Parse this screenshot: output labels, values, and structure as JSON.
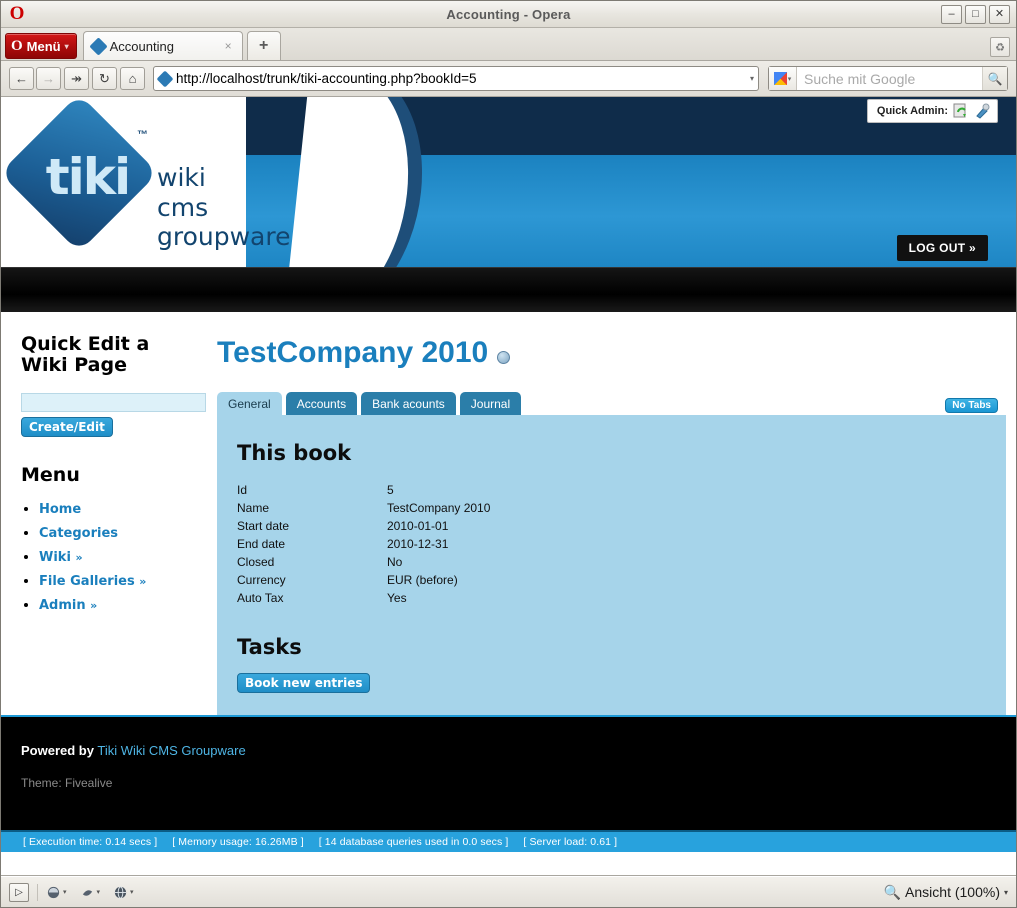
{
  "window": {
    "title": "Accounting - Opera",
    "app_icon": "opera-logo-icon",
    "minimize_label": "–",
    "maximize_label": "□",
    "close_label": "✕"
  },
  "tabbar": {
    "menu_label": "Menü",
    "menu_caret": "▾",
    "tabs": [
      {
        "label": "Accounting",
        "close_label": "×",
        "favicon": "tiki-favicon"
      }
    ],
    "new_tab_label": "+",
    "right_button_icon": "trash-icon"
  },
  "navbar": {
    "back_label": "←",
    "forward_label": "→",
    "fastforward_label": "↠",
    "reload_label": "↻",
    "home_label": "⌂",
    "url": "http://localhost/trunk/tiki-accounting.php?bookId=5",
    "url_dropdown_label": "▾",
    "search_engine_icon": "google-icon",
    "search_engine_caret": "▾",
    "search_placeholder": "Suche mit Google",
    "search_go_icon": "magnifier-icon"
  },
  "banner": {
    "logo_word": "tiki",
    "logo_tm": "™",
    "logo_sub_line1": "wiki",
    "logo_sub_line2": "cms",
    "logo_sub_line3": "groupware",
    "quick_admin_label": "Quick Admin:",
    "quick_admin_icons": [
      "refresh-page-icon",
      "wrench-icon"
    ],
    "logout_label": "LOG OUT »"
  },
  "sidebar": {
    "quick_edit": {
      "title": "Quick Edit a Wiki Page",
      "input_value": "",
      "input_placeholder": "",
      "button_label": "Create/Edit"
    },
    "menu": {
      "title": "Menu",
      "items": [
        {
          "label": "Home",
          "arrow": ""
        },
        {
          "label": "Categories",
          "arrow": ""
        },
        {
          "label": "Wiki",
          "arrow": "»"
        },
        {
          "label": "File Galleries",
          "arrow": "»"
        },
        {
          "label": "Admin",
          "arrow": "»"
        }
      ]
    }
  },
  "main": {
    "page_title": "TestCompany 2010",
    "help_icon": "help-icon",
    "no_tabs_label": "No Tabs",
    "tabs": [
      {
        "label": "General",
        "active": true
      },
      {
        "label": "Accounts",
        "active": false
      },
      {
        "label": "Bank acounts",
        "active": false
      },
      {
        "label": "Journal",
        "active": false
      }
    ],
    "book_section_title": "This book",
    "book_fields": [
      {
        "key": "Id",
        "value": "5"
      },
      {
        "key": "Name",
        "value": "TestCompany 2010"
      },
      {
        "key": "Start date",
        "value": "2010-01-01"
      },
      {
        "key": "End date",
        "value": "2010-12-31"
      },
      {
        "key": "Closed",
        "value": "No"
      },
      {
        "key": "Currency",
        "value": "EUR (before)"
      },
      {
        "key": "Auto Tax",
        "value": "Yes"
      }
    ],
    "tasks_section_title": "Tasks",
    "book_entries_button": "Book new entries"
  },
  "footer": {
    "powered_by_label": "Powered by",
    "powered_by_link": "Tiki Wiki CMS Groupware",
    "theme_line": "Theme: Fivealive",
    "status_items": [
      "[ Execution time: 0.14 secs ]",
      "[ Memory usage: 16.26MB ]",
      "[ 14 database queries used in 0.0 secs ]",
      "[ Server load: 0.61 ]"
    ]
  },
  "statusbar": {
    "panel_toggle_icon": "panel-toggle-icon",
    "items": [
      {
        "icon": "image-mode-icon",
        "caret": "▾"
      },
      {
        "icon": "content-block-icon",
        "caret": "▾"
      },
      {
        "icon": "globe-icon",
        "caret": "▾"
      }
    ],
    "zoom_icon": "magnifier-icon",
    "zoom_label": "Ansicht (100%)",
    "zoom_caret": "▾"
  },
  "colors": {
    "banner_blue": "#1e86c4",
    "banner_dark": "#0f2c4a",
    "content_blue": "#a6d4ea",
    "tab_blue": "#2b7ea9",
    "link_blue": "#1a7fbd",
    "status_blue": "#28a2dd",
    "menu_red": "#b00d0d"
  }
}
